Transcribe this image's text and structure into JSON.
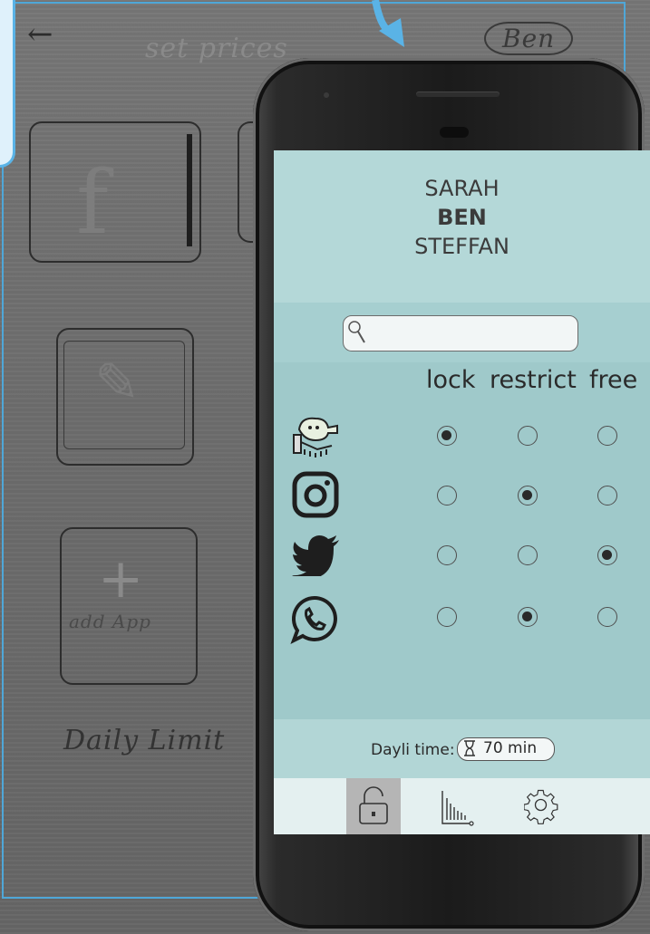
{
  "sketch": {
    "back_arrow": "←",
    "title": "set prices",
    "user": "Ben",
    "add_app": "add App",
    "daily_limit": "Daily Limit"
  },
  "phone": {
    "users": [
      "SARAH",
      "BEN",
      "STEFFAN"
    ],
    "active_user": "BEN",
    "search": {
      "value": "",
      "placeholder": ""
    },
    "columns": [
      "lock",
      "restrict",
      "free"
    ],
    "apps": [
      {
        "name": "doodle-jump-icon",
        "selected": "lock"
      },
      {
        "name": "instagram-icon",
        "selected": "restrict"
      },
      {
        "name": "twitter-icon",
        "selected": "free"
      },
      {
        "name": "whatsapp-icon",
        "selected": "restrict"
      }
    ],
    "daily_time": {
      "label": "Dayli time:",
      "value": "70 min",
      "icon": "hourglass-icon"
    },
    "nav": [
      {
        "name": "lock-icon",
        "active": true
      },
      {
        "name": "chart-icon",
        "active": false
      },
      {
        "name": "settings-icon",
        "active": false
      }
    ],
    "colors": {
      "header_bg": "#b4d8d8",
      "table_bg": "#9fc9ca",
      "nav_bg": "#e4f0f0",
      "accent": "#5ab3e6"
    }
  }
}
